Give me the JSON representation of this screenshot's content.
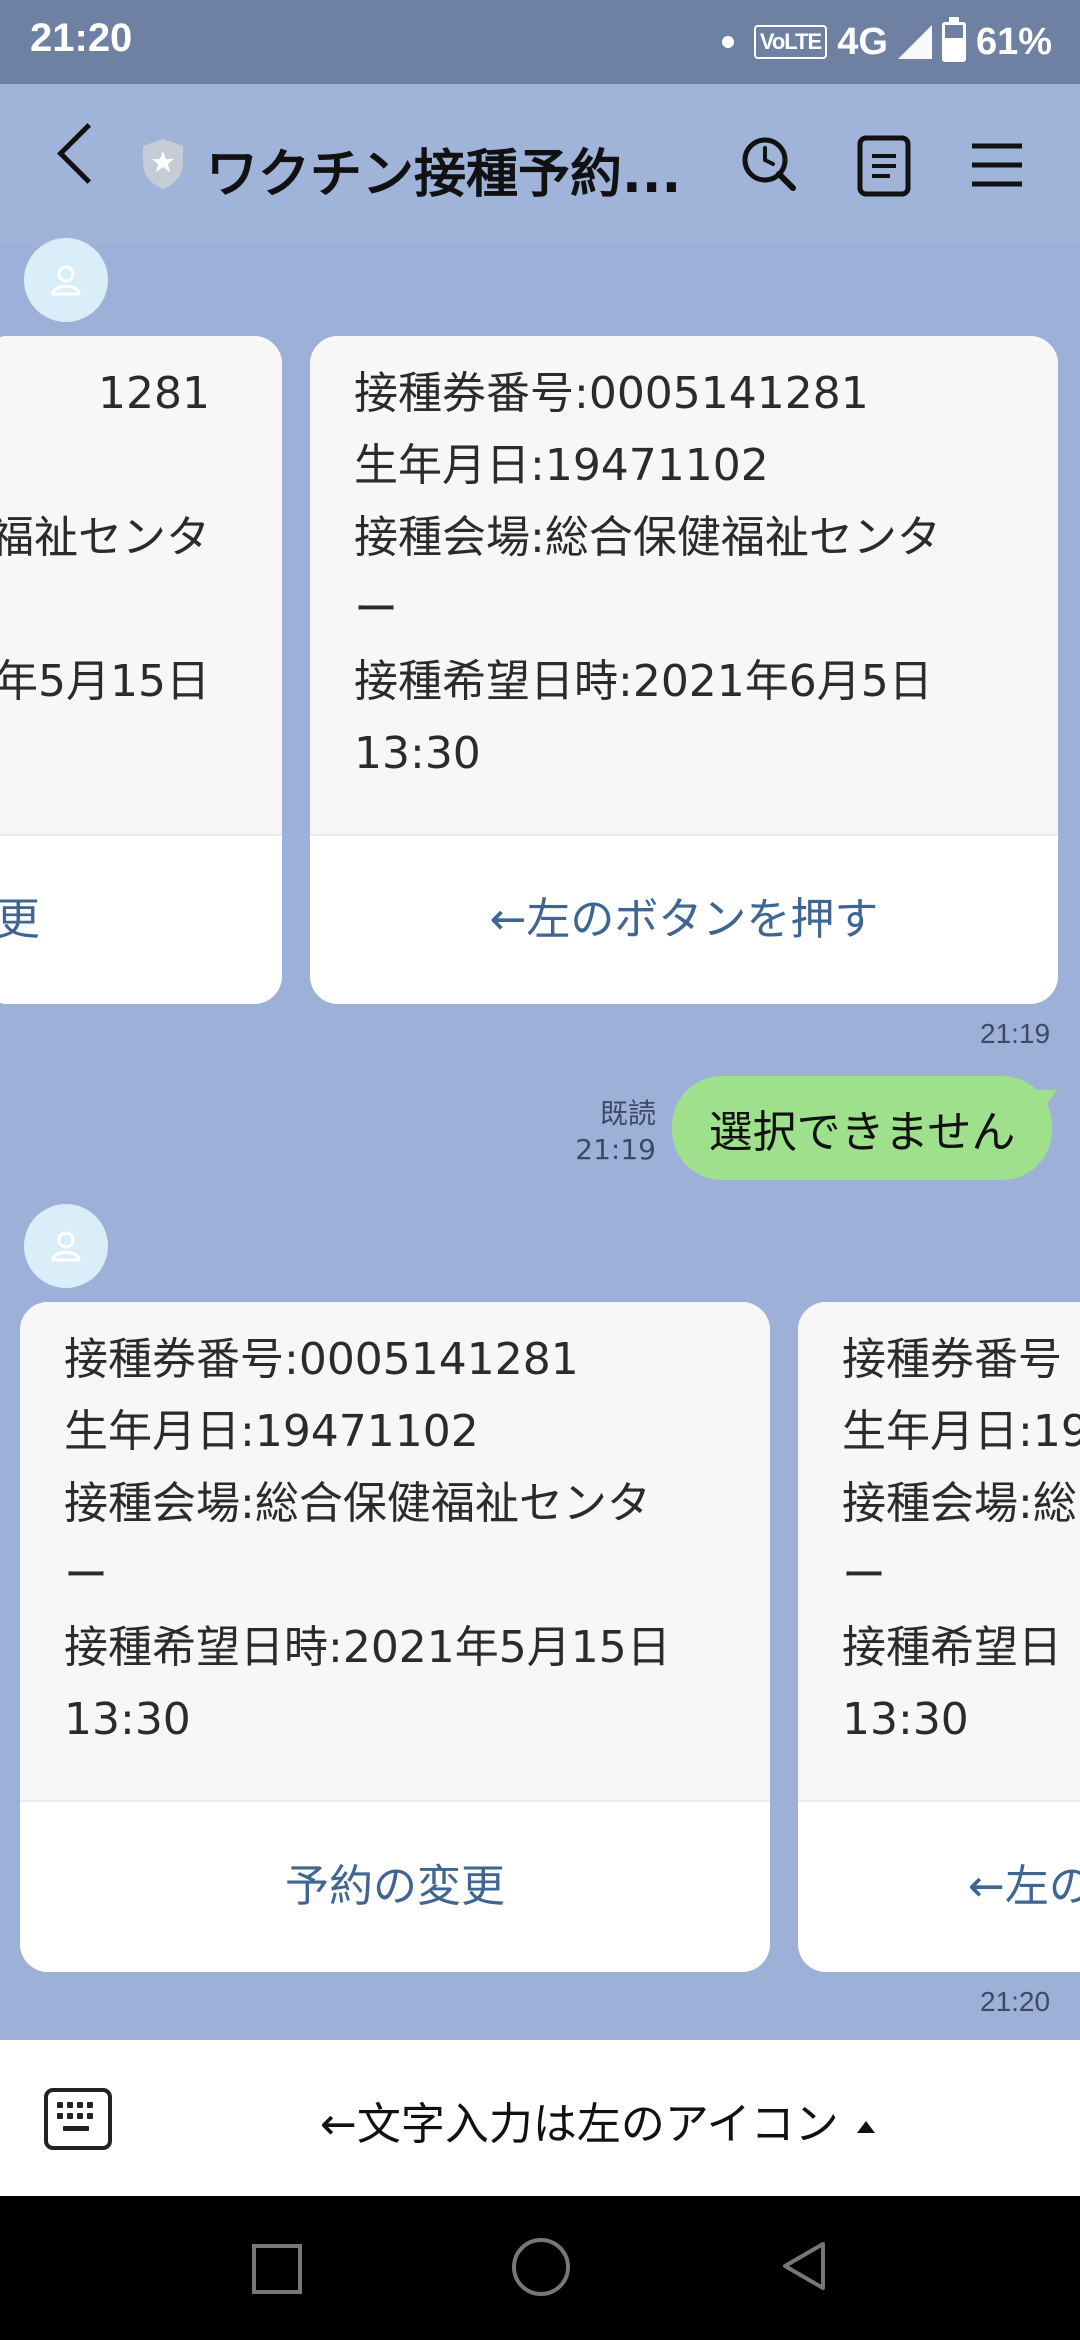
{
  "status_bar": {
    "time": "21:20",
    "volte": "VoLTE",
    "network": "4G",
    "battery": "61%"
  },
  "header": {
    "title": "ワクチン接種予約..."
  },
  "messages": [
    {
      "partial_card": {
        "lines": [
          "1281",
          "",
          "福祉センタ",
          "",
          "年5月15日",
          ""
        ],
        "button": "更"
      },
      "card": {
        "lines": [
          "接種券番号:0005141281",
          "生年月日:19471102",
          "接種会場:総合保健福祉センタ",
          "ー",
          "接種希望日時:2021年6月5日",
          "13:30"
        ],
        "button": "←左のボタンを押す"
      },
      "time": "21:19"
    },
    {
      "sent": {
        "text": "選択できません",
        "read_label": "既読",
        "time": "21:19"
      }
    },
    {
      "card": {
        "lines": [
          "接種券番号:0005141281",
          "生年月日:19471102",
          "接種会場:総合保健福祉センタ",
          "ー",
          "接種希望日時:2021年5月15日",
          "13:30"
        ],
        "button": "予約の変更"
      },
      "partial_card": {
        "lines": [
          "接種券番号",
          "生年月日:19",
          "接種会場:総",
          "ー",
          "接種希望日",
          "13:30"
        ],
        "button": "←左の"
      },
      "time": "21:20"
    }
  ],
  "input_bar": {
    "text": "←文字入力は左のアイコン"
  },
  "icons": [
    "back-icon",
    "shield-icon",
    "search-icon",
    "notes-icon",
    "menu-icon",
    "avatar-icon",
    "keyboard-icon",
    "recents-icon",
    "home-icon",
    "back-nav-icon"
  ]
}
